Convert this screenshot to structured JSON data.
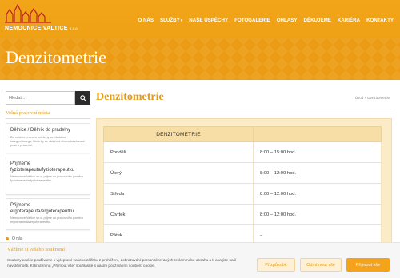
{
  "logo": {
    "text": "NEMOCNICE VALTICE",
    "suffix": "s.r.o.",
    "color": "#b8202a"
  },
  "nav": {
    "items": [
      {
        "label": "O NÁS"
      },
      {
        "label": "SLUŽBY",
        "caret": "▾"
      },
      {
        "label": "NAŠE ÚSPĚCHY"
      },
      {
        "label": "FOTOGALERIE"
      },
      {
        "label": "OHLASY"
      },
      {
        "label": "DĚKUJEME"
      },
      {
        "label": "KARIÉRA"
      },
      {
        "label": "KONTAKTY"
      }
    ]
  },
  "hero": {
    "title": "Denzitometrie"
  },
  "sidebar": {
    "search_placeholder": "Hledat ...",
    "search_icon": "search-icon",
    "heading": "Volná pracovní místa",
    "jobs": [
      {
        "title": "Dělnice / Dělník do prádelny",
        "desc": "Do našeho provozu prádelny se hledáme kolegyni/kolegu, která by se ráda/rád věnovala/věnoval práci v prádelně."
      },
      {
        "title": "Přijmeme fyzioterapeuta/fyzioterapeutku",
        "desc": "Nemocnice Valtice s.r.o. přijme do pracovního poměru fyzioterapeuta/fyzioterapeutku."
      },
      {
        "title": "Přijmeme ergoterapeuta/ergoterapeutku",
        "desc": "Nemocnice Valtice s.r.o. přijme do pracovního poměru ergoterapeuta/ergoterapeutku."
      }
    ],
    "footer_link": "O nás"
  },
  "main": {
    "title": "Denzitometrie",
    "breadcrumb": "Úvod » Denzitometrie",
    "table": {
      "header": "DENZITOMETRIE",
      "rows": [
        {
          "day": "Pondělí",
          "hours": "8:00 – 15:00 hod."
        },
        {
          "day": "Úterý",
          "hours": "8:00 – 12:00 hod."
        },
        {
          "day": "Středa",
          "hours": "8:00 – 12:00 hod."
        },
        {
          "day": "Čtvrtek",
          "hours": "8:00 – 12:00 hod."
        },
        {
          "day": "Pátek",
          "hours": "–"
        }
      ]
    }
  },
  "cookie": {
    "title": "Vážíme si vašeho soukromí",
    "text": "Soubory cookie používáme k vylepšení vašeho zážitku z prohlížení, zobrazování personalizovaných reklam nebo obsahu a k analýze naší návštěvnosti. Kliknutím na „Přijmout vše“ souhlasíte s naším používáním souborů cookie.",
    "buttons": {
      "customize": "Přizpůsobit",
      "reject": "Odmítnout vše",
      "accept": "Přijmout vše"
    }
  },
  "colors": {
    "accent": "#f3a51a",
    "title": "#e39a19"
  }
}
